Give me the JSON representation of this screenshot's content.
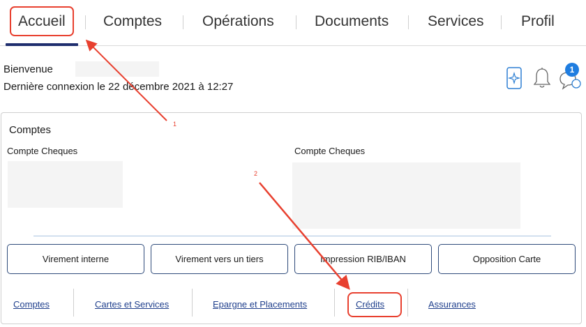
{
  "nav": {
    "items": [
      {
        "label": "Accueil"
      },
      {
        "label": "Comptes"
      },
      {
        "label": "Opérations"
      },
      {
        "label": "Documents"
      },
      {
        "label": "Services"
      },
      {
        "label": "Profil"
      }
    ]
  },
  "welcome": {
    "greeting": "Bienvenue",
    "last_login": "Dernière connexion le 22 décembre 2021 à 12:27"
  },
  "notifications": {
    "count": "1",
    "icons": [
      "mobile-sparkle-icon",
      "bell-icon",
      "chat-icon"
    ]
  },
  "accounts": {
    "title": "Comptes",
    "items": [
      {
        "label": "Compte Cheques"
      },
      {
        "label": "Compte Cheques"
      }
    ]
  },
  "actions": [
    {
      "label": "Virement interne"
    },
    {
      "label": "Virement vers un tiers"
    },
    {
      "label": "Impression RIB/IBAN"
    },
    {
      "label": "Opposition Carte"
    }
  ],
  "links": [
    {
      "label": "Comptes"
    },
    {
      "label": "Cartes et Services"
    },
    {
      "label": "Epargne et Placements"
    },
    {
      "label": "Crédits"
    },
    {
      "label": "Assurances"
    }
  ],
  "annotations": [
    {
      "number": "1"
    },
    {
      "number": "2"
    }
  ],
  "colors": {
    "annotation": "#e8402f",
    "nav_underline": "#1f2e6e",
    "badge": "#1f7de0",
    "link": "#1f3f8c"
  }
}
